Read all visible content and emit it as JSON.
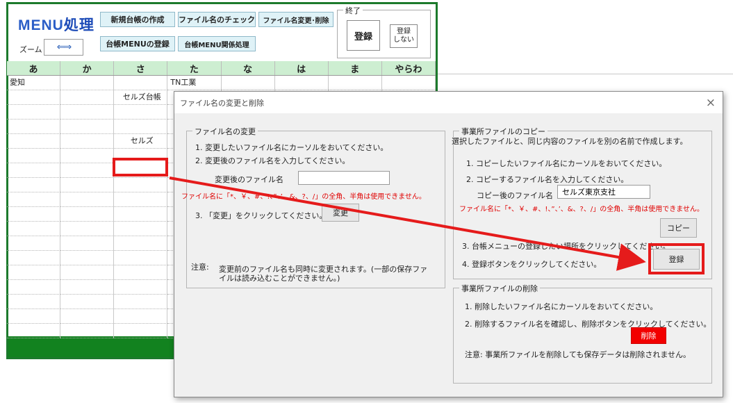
{
  "sheet": {
    "title_latin": "MENU",
    "title_kanji": "処理",
    "buttons": {
      "new_ledger": "新規台帳の作成",
      "check_filename": "ファイル名のチェック",
      "rename_delete": "ファイル名変更･削除",
      "register_ledger_menu": "台帳MENUの登録",
      "ledger_menu_related": "台帳MENU関係処理"
    },
    "zoom_label": "ズーム",
    "zoom_arrows": "⇐⇒",
    "exit": {
      "legend": "終了",
      "register": "登録",
      "no_register_line1": "登録",
      "no_register_line2": "しない"
    },
    "kana_columns": [
      "あ",
      "か",
      "さ",
      "た",
      "な",
      "は",
      "ま",
      "やらわ"
    ],
    "rows": [
      [
        "愛知",
        "",
        "",
        "TN工業",
        "",
        "",
        "",
        ""
      ],
      [
        "",
        "",
        "セルズ台帳",
        "",
        "",
        "",
        "",
        ""
      ],
      [
        "",
        "",
        "",
        "",
        "",
        "",
        "",
        ""
      ],
      [
        "",
        "",
        "",
        "",
        "",
        "",
        "",
        ""
      ],
      [
        "",
        "",
        "セルズ",
        "",
        "",
        "",
        "",
        ""
      ]
    ],
    "accent_green": "#12821f",
    "highlight_red": "#e51b1b"
  },
  "dialog": {
    "title": "ファイル名の変更と削除",
    "close_icon": "×",
    "rename": {
      "legend": "ファイル名の変更",
      "step1": "1. 変更したいファイル名にカーソルをおいてください。",
      "step2": "2. 変更後のファイル名を入力してください。",
      "field_label": "変更後のファイル名",
      "field_value": "",
      "warning": "ファイル名に「*、￥、#、!、”、’、&、?、/」の全角、半角は使用できません。",
      "step3": "3. 「変更」をクリックしてください。",
      "change_button": "変更",
      "note_label": "注意:",
      "note_line1": "変更前のファイル名も同時に変更されます。(一部の保存ファ",
      "note_line2": "イルは読み込むことができません。)"
    },
    "copy": {
      "legend": "事業所ファイルのコピー",
      "desc": "選択したファイルと、同じ内容のファイルを別の名前で作成します。",
      "step1": "1. コピーしたいファイル名にカーソルをおいてください。",
      "step2": "2. コピーするファイル名を入力してください。",
      "field_label": "コピー後のファイル名",
      "field_value": "セルズ東京支社",
      "warning": "ファイル名に「*、￥、#、!、”、’、&、?、/」の全角、半角は使用できません。",
      "copy_button": "コピー",
      "step3": "3. 台帳メニューの登録したい場所をクリックしてください。",
      "step4": "4. 登録ボタンをクリックしてください。",
      "register_button": "登録"
    },
    "delete": {
      "legend": "事業所ファイルの削除",
      "step1": "1. 削除したいファイル名にカーソルをおいてください。",
      "step2": "2. 削除するファイル名を確認し、削除ボタンをクリックしてください。",
      "delete_button": "削除",
      "note": "注意:  事業所ファイルを削除しても保存データは削除されません。",
      "delete_color": "#f20000"
    }
  }
}
